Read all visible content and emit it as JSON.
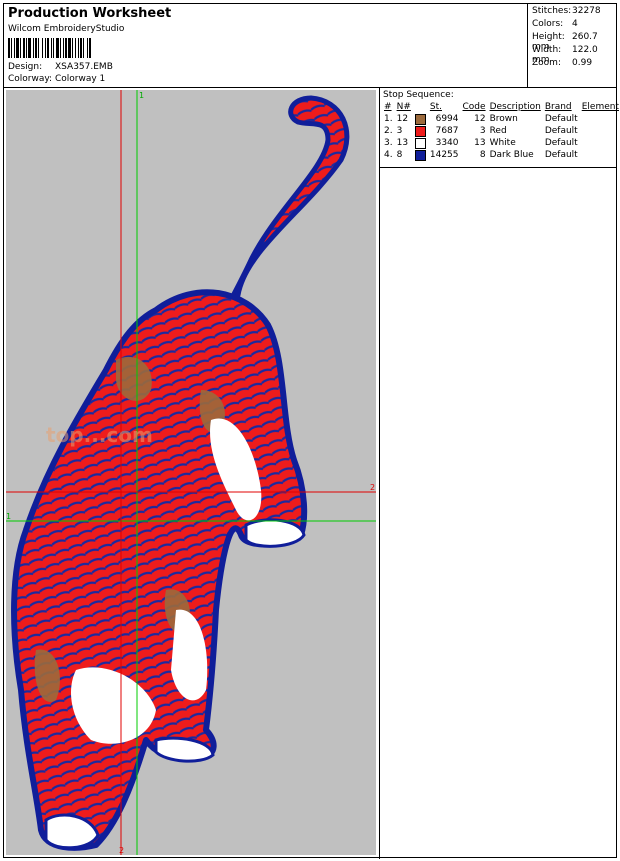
{
  "header": {
    "title": "Production Worksheet",
    "subtitle": "Wilcom EmbroideryStudio",
    "design_label": "Design:",
    "design_value": "XSA357.EMB",
    "colorway_label": "Colorway:",
    "colorway_value": "Colorway 1"
  },
  "stats": [
    {
      "label": "Stitches:",
      "value": "32278"
    },
    {
      "label": "Colors:",
      "value": "4"
    },
    {
      "label": "Height:",
      "value": "260.7 mm"
    },
    {
      "label": "Width:",
      "value": "122.0 mm"
    },
    {
      "label": "Zoom:",
      "value": "0.99"
    }
  ],
  "stop_sequence": {
    "label": "Stop Sequence:",
    "columns": {
      "hash": "#",
      "n": "N#",
      "st": "St.",
      "code": "Code",
      "desc": "Description",
      "brand": "Brand",
      "element": "Element"
    },
    "rows": [
      {
        "idx": "1.",
        "n": "12",
        "color": "#9b6a3c",
        "st": "6994",
        "code": "12",
        "desc": "Brown",
        "brand": "Default"
      },
      {
        "idx": "2.",
        "n": "3",
        "color": "#ee1c1c",
        "st": "7687",
        "code": "3",
        "desc": "Red",
        "brand": "Default"
      },
      {
        "idx": "3.",
        "n": "13",
        "color": "#ffffff",
        "st": "3340",
        "code": "13",
        "desc": "White",
        "brand": "Default"
      },
      {
        "idx": "4.",
        "n": "8",
        "color": "#101e9a",
        "st": "14255",
        "code": "8",
        "desc": "Dark Blue",
        "brand": "Default"
      }
    ]
  },
  "design_view": {
    "watermark": "top...com",
    "markers": [
      "1",
      "1",
      "2",
      "2"
    ],
    "colors": {
      "background": "#c0c0c0",
      "guide_green": "#00cc00",
      "guide_red": "#e00000"
    }
  }
}
